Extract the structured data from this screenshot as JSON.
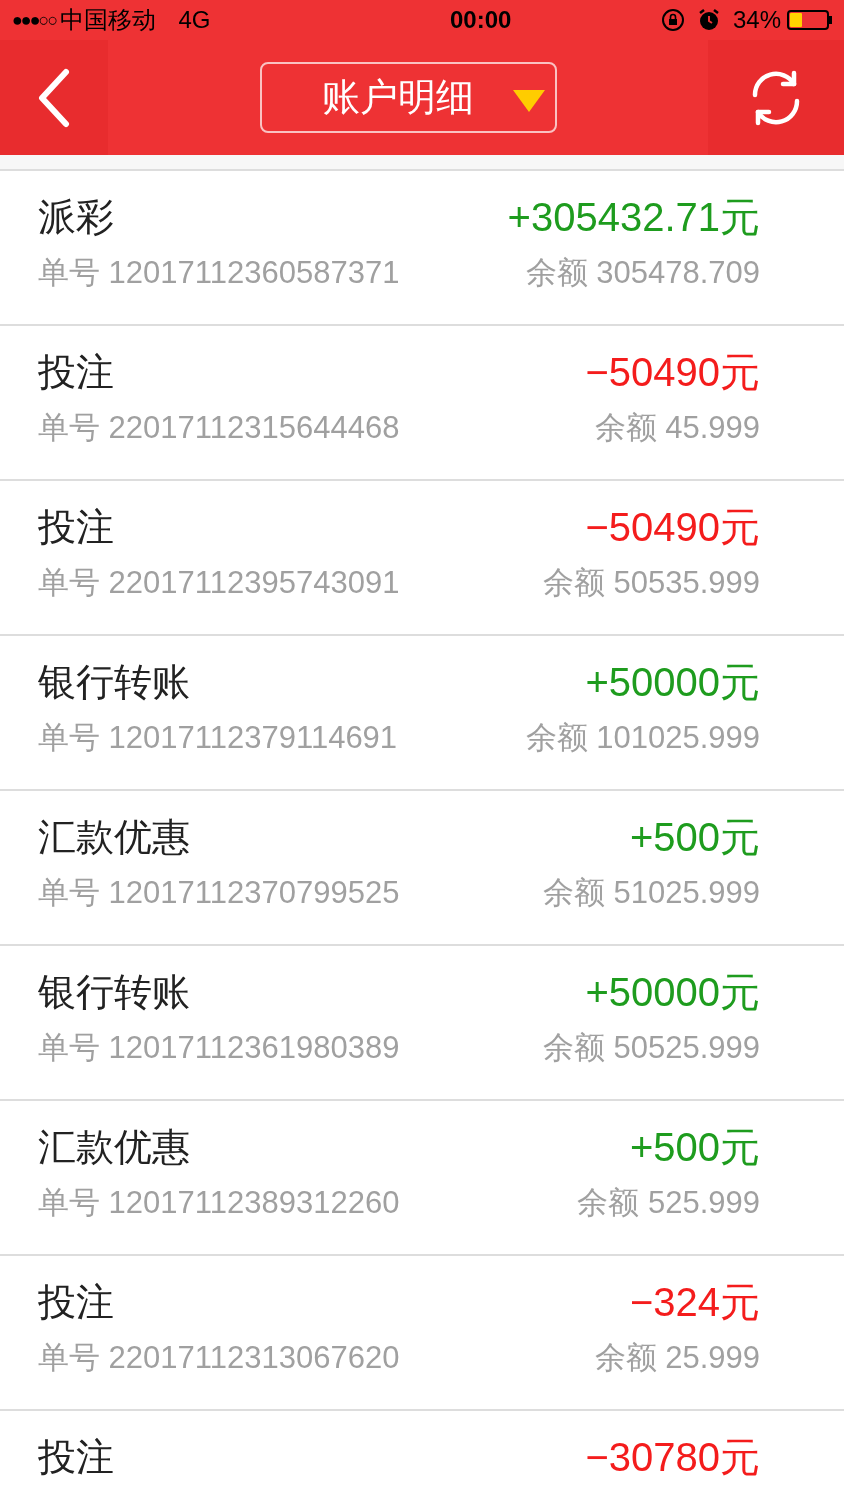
{
  "status_bar": {
    "signal_dots": "●●●○○",
    "carrier": "中国移动",
    "network": "4G",
    "time": "00:00",
    "battery_percent": "34%"
  },
  "nav": {
    "title": "账户明细"
  },
  "records": [
    {
      "title": "派彩",
      "order": "单号 12017112360587371",
      "amount": "+305432.71元",
      "balance": "余额 305478.709",
      "kind": "income"
    },
    {
      "title": "投注",
      "order": "单号 22017112315644468",
      "amount": "−50490元",
      "balance": "余额 45.999",
      "kind": "expense"
    },
    {
      "title": "投注",
      "order": "单号 22017112395743091",
      "amount": "−50490元",
      "balance": "余额 50535.999",
      "kind": "expense"
    },
    {
      "title": "银行转账",
      "order": "单号 12017112379114691",
      "amount": "+50000元",
      "balance": "余额 101025.999",
      "kind": "income"
    },
    {
      "title": "汇款优惠",
      "order": "单号 12017112370799525",
      "amount": "+500元",
      "balance": "余额 51025.999",
      "kind": "income"
    },
    {
      "title": "银行转账",
      "order": "单号 12017112361980389",
      "amount": "+50000元",
      "balance": "余额 50525.999",
      "kind": "income"
    },
    {
      "title": "汇款优惠",
      "order": "单号 12017112389312260",
      "amount": "+500元",
      "balance": "余额 525.999",
      "kind": "income"
    },
    {
      "title": "投注",
      "order": "单号 22017112313067620",
      "amount": "−324元",
      "balance": "余额 25.999",
      "kind": "expense"
    },
    {
      "title": "投注",
      "amount": "−30780元",
      "kind": "expense"
    }
  ]
}
